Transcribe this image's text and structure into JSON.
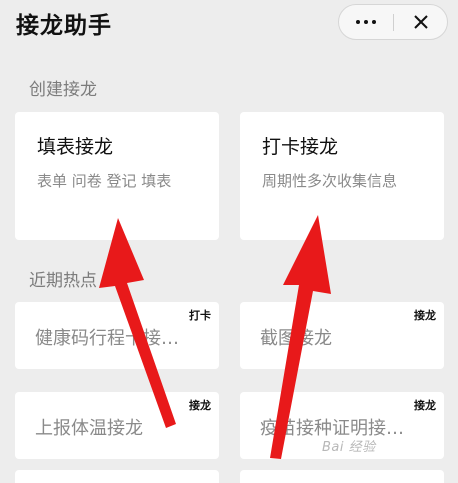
{
  "header": {
    "title": "接龙助手"
  },
  "icons": {
    "more": "more-dots-icon",
    "close": "close-icon"
  },
  "sections": {
    "create_label": "创建接龙",
    "hot_label": "近期热点"
  },
  "create_cards": [
    {
      "title": "填表接龙",
      "desc": "表单 问卷 登记 填表"
    },
    {
      "title": "打卡接龙",
      "desc": "周期性多次收集信息"
    }
  ],
  "hot_items": [
    {
      "label": "健康码行程卡接…",
      "tag": "打卡"
    },
    {
      "label": "截图接龙",
      "tag": "接龙"
    },
    {
      "label": "上报体温接龙",
      "tag": "接龙"
    },
    {
      "label": "疫苗接种证明接…",
      "tag": "接龙"
    }
  ],
  "watermark": "Bai 经验",
  "colors": {
    "arrow": "#e8191a",
    "background": "#ededed",
    "card": "#ffffff"
  }
}
